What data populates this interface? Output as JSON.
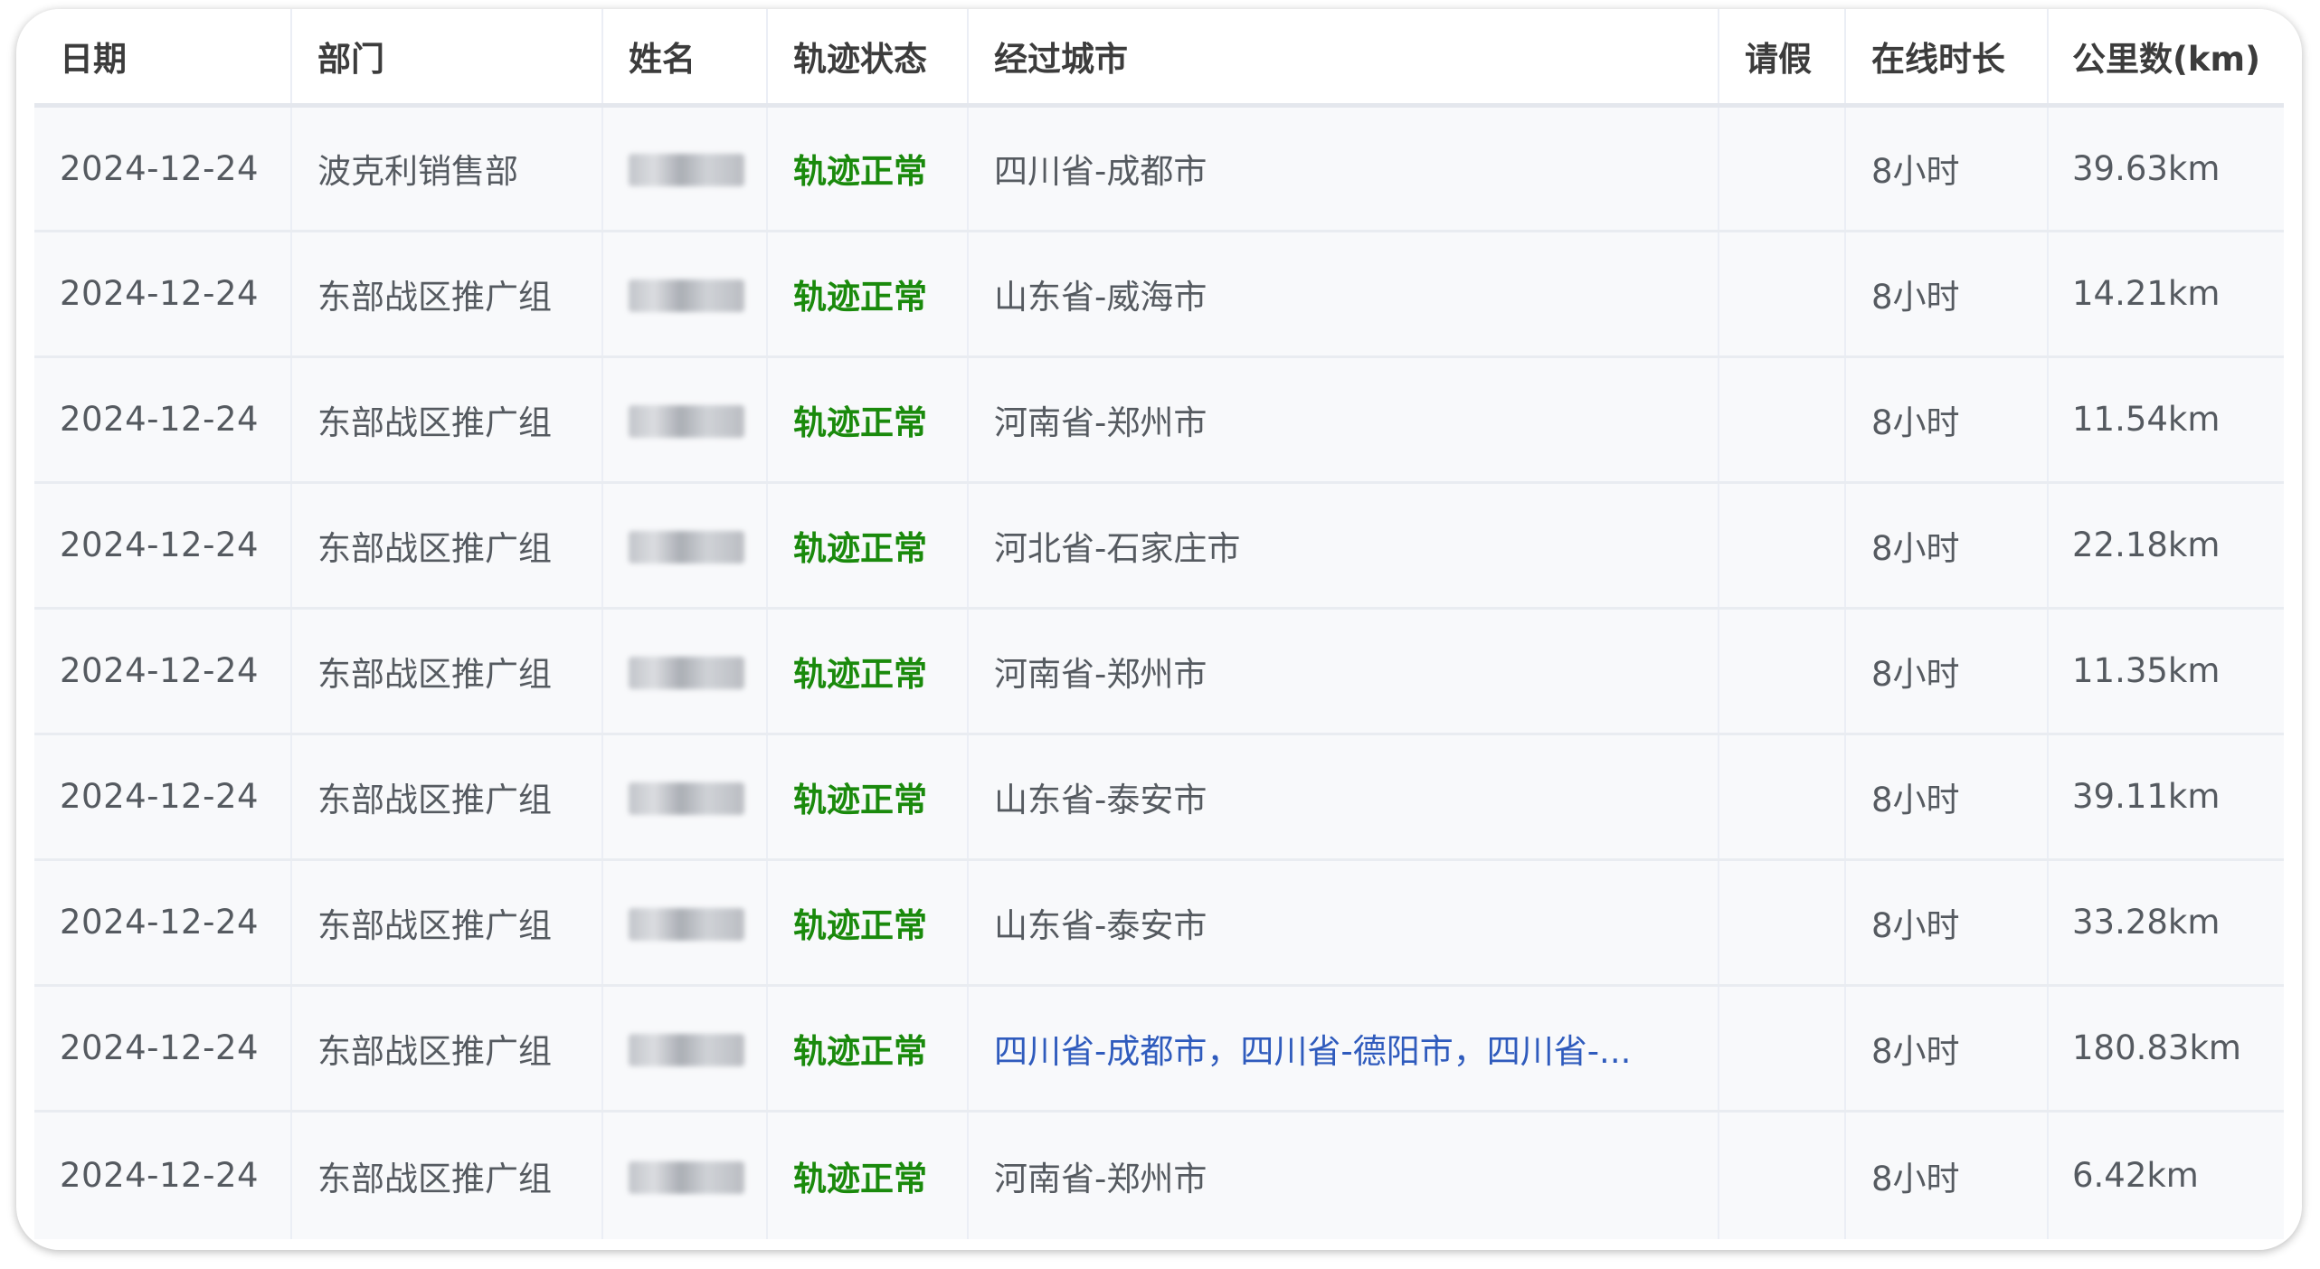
{
  "table": {
    "headers": {
      "date": "日期",
      "dept": "部门",
      "name": "姓名",
      "status": "轨迹状态",
      "cities": "经过城市",
      "leave": "请假",
      "online": "在线时长",
      "km": "公里数(km)"
    },
    "rows": [
      {
        "date": "2024-12-24",
        "dept": "波克利销售部",
        "status": "轨迹正常",
        "cities": "四川省-成都市",
        "leave": "",
        "online": "8小时",
        "km": "39.63km"
      },
      {
        "date": "2024-12-24",
        "dept": "东部战区推广组",
        "status": "轨迹正常",
        "cities": "山东省-威海市",
        "leave": "",
        "online": "8小时",
        "km": "14.21km"
      },
      {
        "date": "2024-12-24",
        "dept": "东部战区推广组",
        "status": "轨迹正常",
        "cities": "河南省-郑州市",
        "leave": "",
        "online": "8小时",
        "km": "11.54km"
      },
      {
        "date": "2024-12-24",
        "dept": "东部战区推广组",
        "status": "轨迹正常",
        "cities": "河北省-石家庄市",
        "leave": "",
        "online": "8小时",
        "km": "22.18km"
      },
      {
        "date": "2024-12-24",
        "dept": "东部战区推广组",
        "status": "轨迹正常",
        "cities": "河南省-郑州市",
        "leave": "",
        "online": "8小时",
        "km": "11.35km"
      },
      {
        "date": "2024-12-24",
        "dept": "东部战区推广组",
        "status": "轨迹正常",
        "cities": "山东省-泰安市",
        "leave": "",
        "online": "8小时",
        "km": "39.11km"
      },
      {
        "date": "2024-12-24",
        "dept": "东部战区推广组",
        "status": "轨迹正常",
        "cities": "山东省-泰安市",
        "leave": "",
        "online": "8小时",
        "km": "33.28km"
      },
      {
        "date": "2024-12-24",
        "dept": "东部战区推广组",
        "status": "轨迹正常",
        "cities": "四川省-成都市，四川省-德阳市，四川省-...",
        "leave": "",
        "online": "8小时",
        "km": "180.83km"
      },
      {
        "date": "2024-12-24",
        "dept": "东部战区推广组",
        "status": "轨迹正常",
        "cities": "河南省-郑州市",
        "leave": "",
        "online": "8小时",
        "km": "6.42km"
      }
    ]
  },
  "colors": {
    "status_normal": "#1a8a0c",
    "link": "#2f5bbd",
    "header_text": "#3c3c3c",
    "cell_text": "#555a60",
    "row_background": "#f8f9fb"
  }
}
